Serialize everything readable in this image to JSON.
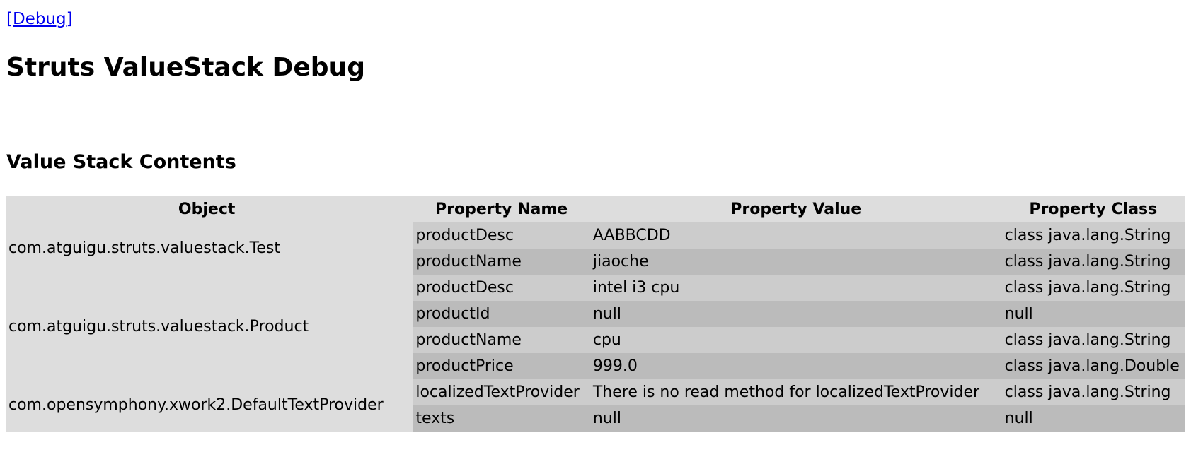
{
  "header": {
    "debug_link": "[Debug]",
    "title": "Struts ValueStack Debug",
    "section_title": "Value Stack Contents"
  },
  "table": {
    "columns": [
      "Object",
      "Property Name",
      "Property Value",
      "Property Class"
    ],
    "objects": [
      {
        "name": "com.atguigu.struts.valuestack.Test",
        "properties": [
          {
            "name": "productDesc",
            "value": "AABBCDD",
            "class": "class java.lang.String"
          },
          {
            "name": "productName",
            "value": "jiaoche",
            "class": "class java.lang.String"
          }
        ]
      },
      {
        "name": "com.atguigu.struts.valuestack.Product",
        "properties": [
          {
            "name": "productDesc",
            "value": "intel i3 cpu",
            "class": "class java.lang.String"
          },
          {
            "name": "productId",
            "value": "null",
            "class": "null"
          },
          {
            "name": "productName",
            "value": "cpu",
            "class": "class java.lang.String"
          },
          {
            "name": "productPrice",
            "value": "999.0",
            "class": "class java.lang.Double"
          }
        ]
      },
      {
        "name": "com.opensymphony.xwork2.DefaultTextProvider",
        "properties": [
          {
            "name": "localizedTextProvider",
            "value": "There is no read method for localizedTextProvider",
            "class": "class java.lang.String"
          },
          {
            "name": "texts",
            "value": "null",
            "class": "null"
          }
        ]
      }
    ]
  },
  "colors": {
    "header_bg": "#dddddd",
    "row_light": "#cccccc",
    "row_dark": "#bbbbbb",
    "link": "#0000ee"
  }
}
